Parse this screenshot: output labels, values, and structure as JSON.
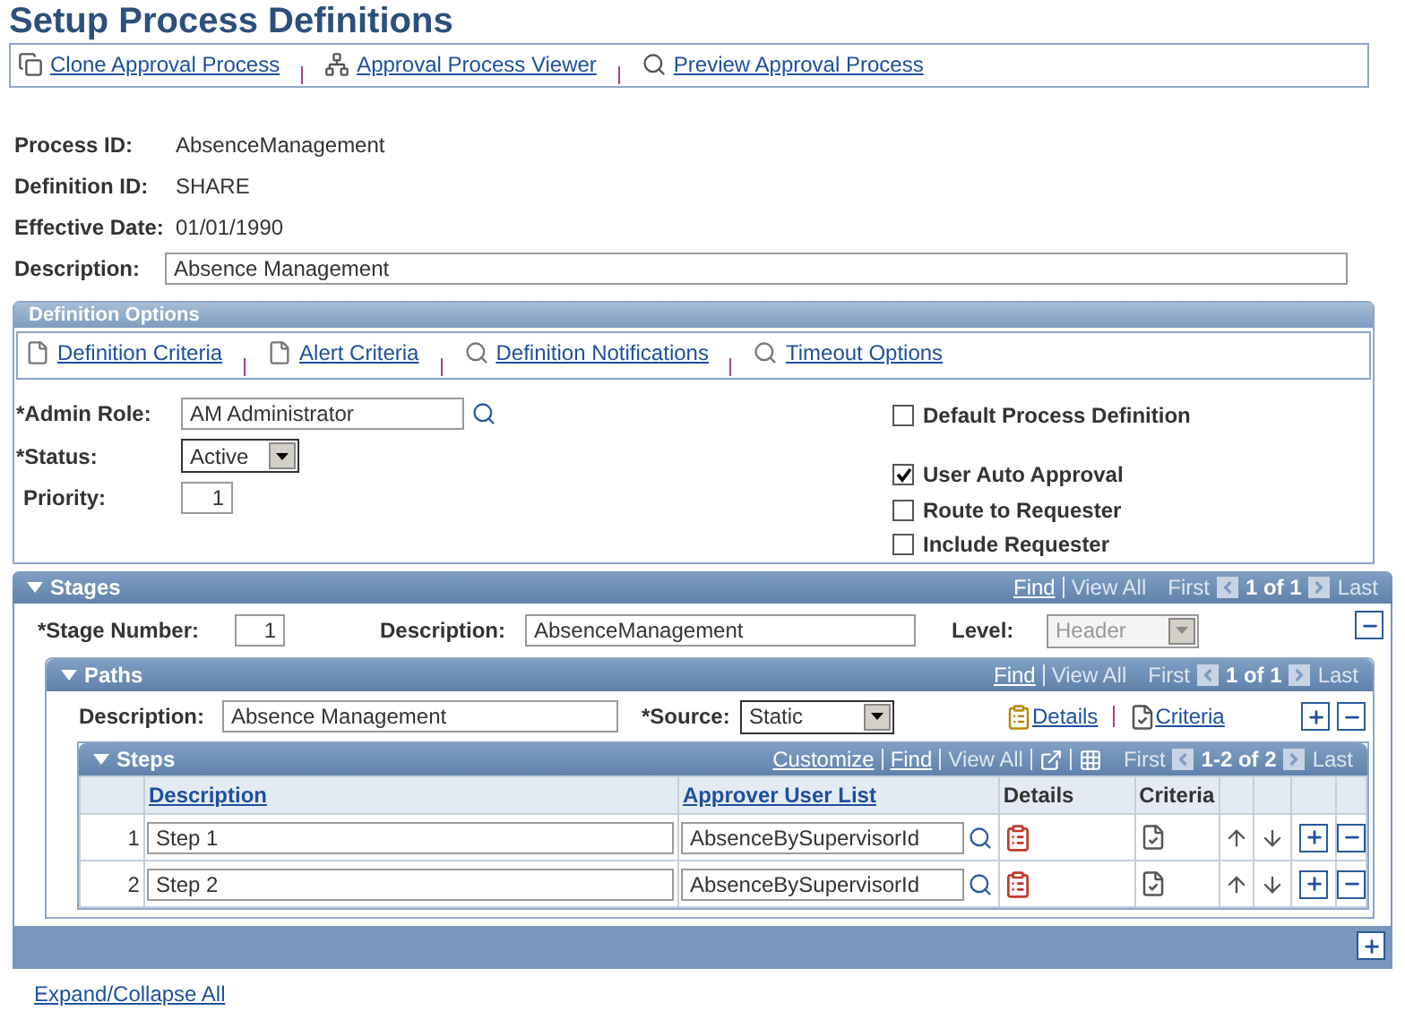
{
  "page_title": "Setup Process Definitions",
  "toolbar_links": [
    "Clone Approval Process",
    "Approval Process Viewer",
    "Preview Approval Process"
  ],
  "fields": [
    {
      "label": "Process ID:",
      "value": "AbsenceManagement",
      "kind": "text"
    },
    {
      "label": "Definition ID:",
      "value": "SHARE",
      "kind": "text"
    },
    {
      "label": "Effective Date:",
      "value": "01/01/1990",
      "kind": "text"
    },
    {
      "label": "Description:",
      "value": "Absence Management",
      "kind": "input"
    }
  ],
  "definition_options": {
    "title": "Definition Options",
    "links": [
      "Definition Criteria",
      "Alert Criteria",
      "Definition Notifications",
      "Timeout Options"
    ],
    "admin_role": {
      "label": "*Admin Role:",
      "value": "AM Administrator"
    },
    "status": {
      "label": "*Status:",
      "value": "Active"
    },
    "priority": {
      "label": "Priority:",
      "value": "1"
    },
    "checkboxes": [
      {
        "label": "Default Process Definition",
        "checked": false
      },
      {
        "label": "User Auto Approval",
        "checked": true
      },
      {
        "label": "Route to Requester",
        "checked": false
      },
      {
        "label": "Include Requester",
        "checked": false
      }
    ]
  },
  "stages": {
    "title": "Stages",
    "nav": {
      "links": [
        {
          "label": "Find",
          "disabled": false
        },
        {
          "label": "View All",
          "disabled": true
        }
      ],
      "first": "First",
      "count": "1 of 1",
      "last": "Last"
    },
    "stage_number": {
      "label": "*Stage Number:",
      "value": "1"
    },
    "description": {
      "label": "Description:",
      "value": "AbsenceManagement"
    },
    "level": {
      "label": "Level:",
      "value": "Header",
      "disabled": true
    },
    "paths": {
      "title": "Paths",
      "nav": {
        "links": [
          {
            "label": "Find",
            "disabled": false
          },
          {
            "label": "View All",
            "disabled": true
          }
        ],
        "first": "First",
        "count": "1 of 1",
        "last": "Last"
      },
      "description": {
        "label": "Description:",
        "value": "Absence Management"
      },
      "source": {
        "label": "*Source:",
        "value": "Static"
      },
      "links": [
        "Details",
        "Criteria"
      ],
      "steps": {
        "title": "Steps",
        "nav": {
          "links": [
            {
              "label": "Customize",
              "disabled": false
            },
            {
              "label": "Find",
              "disabled": false
            },
            {
              "label": "View All",
              "disabled": true
            }
          ],
          "first": "First",
          "count": "1-2 of 2",
          "last": "Last"
        },
        "columns": [
          "Description",
          "Approver User List",
          "Details",
          "Criteria"
        ],
        "rows": [
          {
            "number": "1",
            "description": "Step 1",
            "approver": "AbsenceBySupervisorId"
          },
          {
            "number": "2",
            "description": "Step 2",
            "approver": "AbsenceBySupervisorId"
          }
        ]
      }
    }
  },
  "expand_link": "Expand/Collapse All"
}
